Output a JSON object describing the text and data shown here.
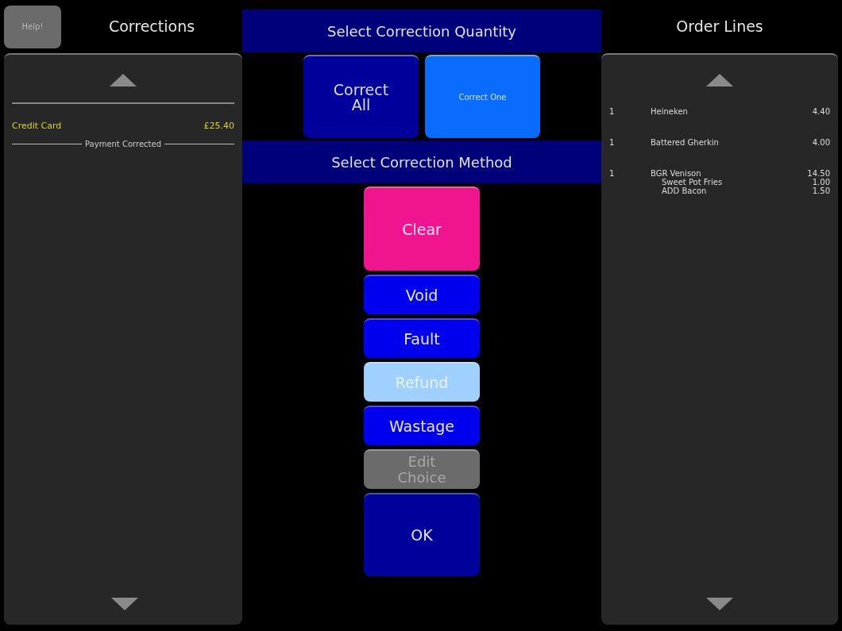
{
  "help_button": "Help!",
  "corrections": {
    "title": "Corrections",
    "payments": [
      {
        "label": "Credit Card",
        "amount": "£25.40",
        "status": "Payment Corrected"
      }
    ]
  },
  "quantity": {
    "title": "Select Correction Quantity",
    "options": [
      {
        "label": "Correct All",
        "selected": false
      },
      {
        "label": "Correct One",
        "selected": true
      }
    ]
  },
  "method": {
    "title": "Select Correction Method",
    "options": [
      {
        "label": "Clear",
        "kind": "clear"
      },
      {
        "label": "Void",
        "kind": "normal"
      },
      {
        "label": "Fault",
        "kind": "normal"
      },
      {
        "label": "Refund",
        "kind": "highlight"
      },
      {
        "label": "Wastage",
        "kind": "normal"
      },
      {
        "label": "Edit Choice",
        "kind": "disabled"
      },
      {
        "label": "OK",
        "kind": "confirm"
      }
    ]
  },
  "order_lines": {
    "title": "Order Lines",
    "items": [
      {
        "qty": "1",
        "name": "Heineken",
        "price": "4.40"
      },
      {
        "qty": "1",
        "name": "Battered Gherkin",
        "price": "4.00"
      },
      {
        "qty": "1",
        "name": "BGR Venison",
        "price": "14.50",
        "children": [
          {
            "name": "Sweet Pot Fries",
            "price": "1.00"
          },
          {
            "name": "ADD Bacon",
            "price": "1.50"
          }
        ]
      }
    ]
  }
}
